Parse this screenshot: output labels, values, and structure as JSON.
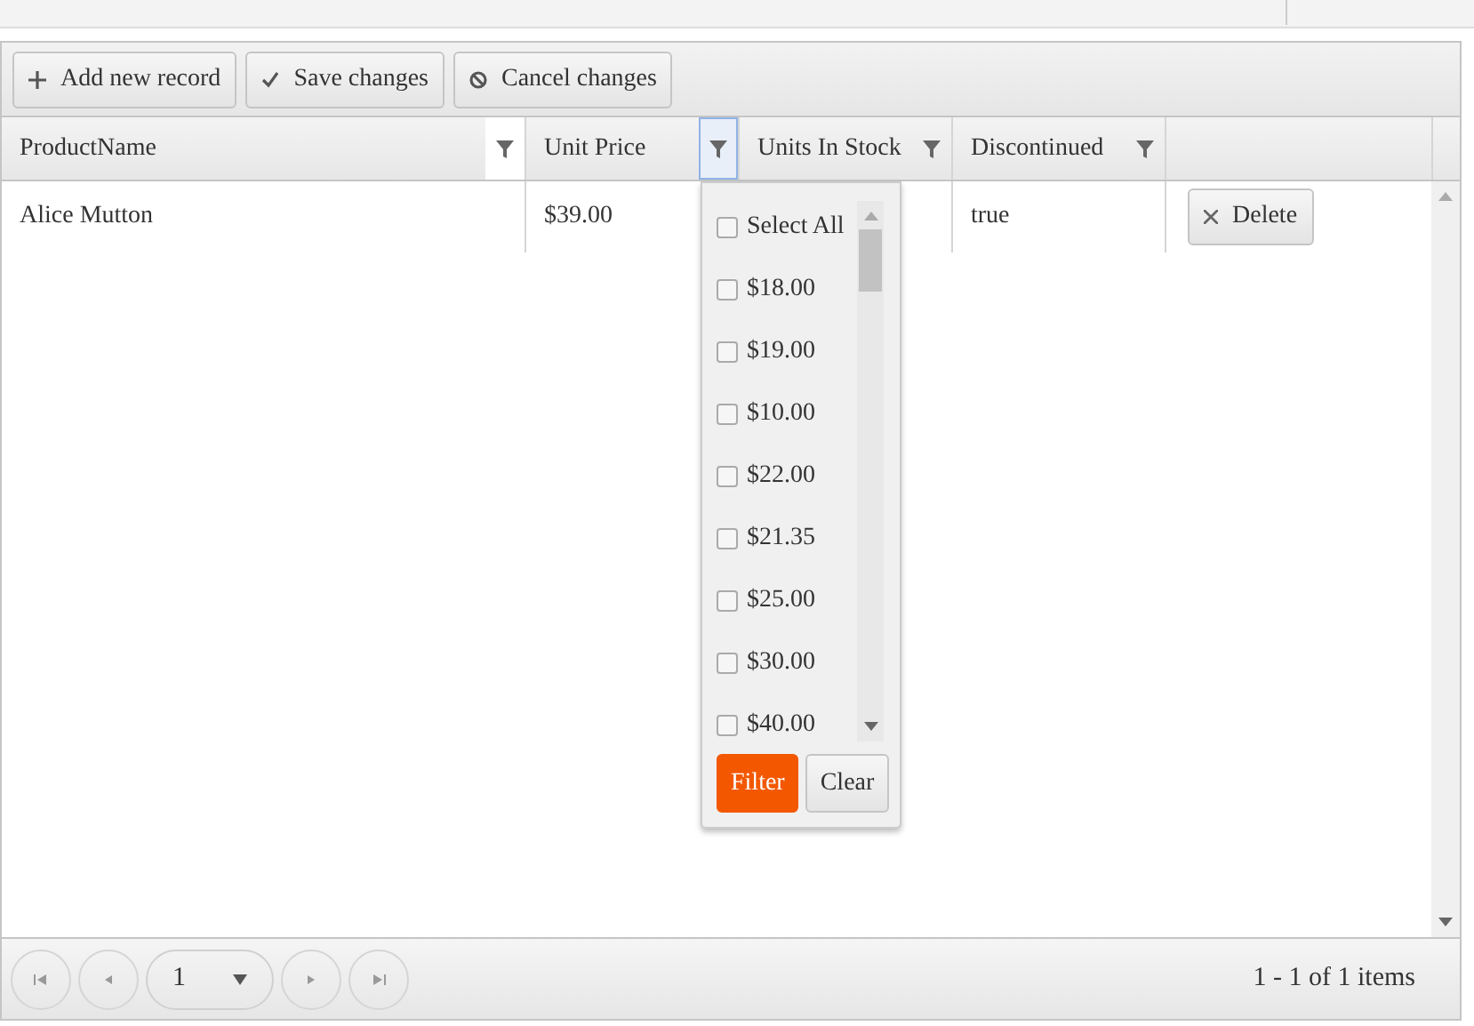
{
  "toolbar": [
    {
      "kind": "add",
      "label": "Add new record"
    },
    {
      "kind": "save",
      "label": "Save changes"
    },
    {
      "kind": "cancel",
      "label": "Cancel changes"
    }
  ],
  "columns": [
    {
      "title": "ProductName",
      "filter_open": false
    },
    {
      "title": "Unit Price",
      "filter_open": true
    },
    {
      "title": "Units In Stock",
      "filter_open": false
    },
    {
      "title": "Discontinued",
      "filter_open": false
    }
  ],
  "rows": [
    {
      "product_name": "Alice Mutton",
      "unit_price": "$39.00",
      "discontinued": "true",
      "command": "Delete"
    }
  ],
  "filter_menu": {
    "items": [
      {
        "label": "Select All",
        "checked": false
      },
      {
        "label": "$18.00",
        "checked": false
      },
      {
        "label": "$19.00",
        "checked": false
      },
      {
        "label": "$10.00",
        "checked": false
      },
      {
        "label": "$22.00",
        "checked": false
      },
      {
        "label": "$21.35",
        "checked": false
      },
      {
        "label": "$25.00",
        "checked": false
      },
      {
        "label": "$30.00",
        "checked": false
      },
      {
        "label": "$40.00",
        "checked": false
      }
    ],
    "buttons": [
      {
        "label": "Filter",
        "primary": true
      },
      {
        "label": "Clear",
        "primary": false
      }
    ]
  },
  "pager": {
    "page": "1",
    "info": "1 - 1 of 1 items"
  }
}
